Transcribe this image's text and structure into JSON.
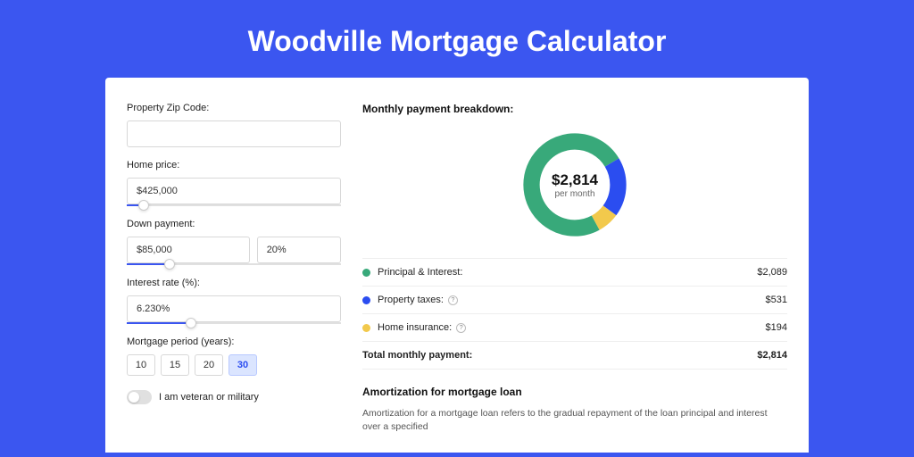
{
  "page_title": "Woodville Mortgage Calculator",
  "form": {
    "zip": {
      "label": "Property Zip Code:",
      "value": ""
    },
    "home_price": {
      "label": "Home price:",
      "value": "$425,000",
      "slider_pct": 8
    },
    "down_payment": {
      "label": "Down payment:",
      "value": "$85,000",
      "pct_value": "20%",
      "slider_pct": 20
    },
    "interest": {
      "label": "Interest rate (%):",
      "value": "6.230%",
      "slider_pct": 30
    },
    "period": {
      "label": "Mortgage period (years):",
      "options": [
        "10",
        "15",
        "20",
        "30"
      ],
      "active_index": 3
    },
    "veteran": {
      "label": "I am veteran or military",
      "on": false
    }
  },
  "breakdown": {
    "title": "Monthly payment breakdown:",
    "center_value": "$2,814",
    "center_sub": "per month",
    "rows": [
      {
        "color": "#38a97a",
        "label": "Principal & Interest:",
        "value": "$2,089",
        "info": false
      },
      {
        "color": "#2b4df0",
        "label": "Property taxes:",
        "value": "$531",
        "info": true
      },
      {
        "color": "#f2c94c",
        "label": "Home insurance:",
        "value": "$194",
        "info": true
      }
    ],
    "total": {
      "label": "Total monthly payment:",
      "value": "$2,814"
    }
  },
  "amort": {
    "title": "Amortization for mortgage loan",
    "text": "Amortization for a mortgage loan refers to the gradual repayment of the loan principal and interest over a specified"
  },
  "chart_data": {
    "type": "pie",
    "title": "Monthly payment breakdown",
    "series": [
      {
        "name": "Principal & Interest",
        "value": 2089,
        "color": "#38a97a"
      },
      {
        "name": "Property taxes",
        "value": 531,
        "color": "#2b4df0"
      },
      {
        "name": "Home insurance",
        "value": 194,
        "color": "#f2c94c"
      }
    ],
    "total": 2814,
    "center_label": "$2,814 per month"
  }
}
